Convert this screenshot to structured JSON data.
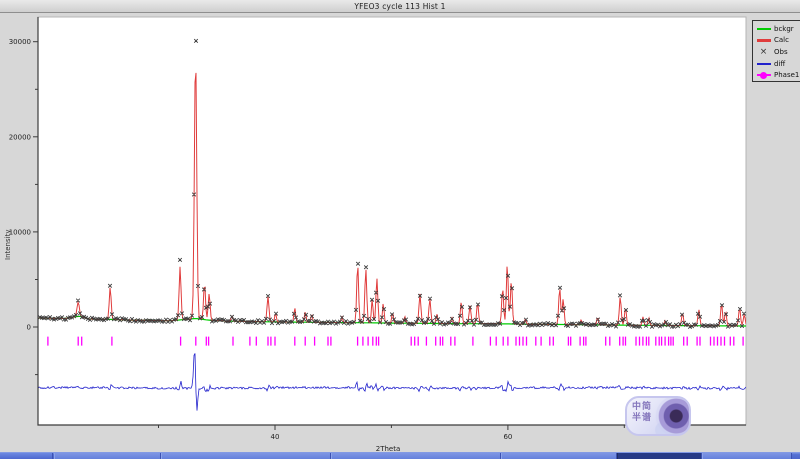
{
  "window": {
    "title": "YFEO3 cycle 113 Hist 1"
  },
  "legend": {
    "items": [
      {
        "label": "bckgr",
        "color": "#00cc00",
        "symbol": "line"
      },
      {
        "label": "Calc",
        "color": "#e03c3c",
        "symbol": "line-thick"
      },
      {
        "label": "Obs",
        "color": "#3a3a3a",
        "symbol": "x-marker"
      },
      {
        "label": "diff",
        "color": "#2222cc",
        "symbol": "line"
      },
      {
        "label": "Phase1",
        "color": "#ff00ff",
        "symbol": "line-diamond"
      }
    ]
  },
  "watermark": {
    "lines": [
      "中简",
      "半谱"
    ]
  },
  "taskbar": {
    "button_count": 6
  },
  "chart_data": {
    "type": "line",
    "title": "YFEO3 cycle 113 Hist 1",
    "xlabel": "2Theta",
    "ylabel": "Intensity",
    "xlim": [
      19.65,
      80.45
    ],
    "ylim": [
      -10300,
      32600
    ],
    "x_ticks_labeled": [
      40,
      60
    ],
    "x_ticks_minor": [
      30,
      50,
      70
    ],
    "y_ticks_labeled": [
      0,
      10000,
      20000,
      30000
    ],
    "y_ticks_minor": [
      -5000,
      5000,
      15000,
      25000
    ],
    "grid": false,
    "legend_position": "top-right",
    "series_names": [
      "bckgr",
      "Calc",
      "Obs",
      "diff",
      "Phase1"
    ],
    "background_points": [
      [
        19.65,
        950
      ],
      [
        22.0,
        900
      ],
      [
        23.2,
        1150
      ],
      [
        24.0,
        850
      ],
      [
        26.0,
        800
      ],
      [
        28.0,
        720
      ],
      [
        31.0,
        660
      ],
      [
        33.2,
        900
      ],
      [
        34.5,
        700
      ],
      [
        36.0,
        620
      ],
      [
        40.0,
        540
      ],
      [
        45.0,
        480
      ],
      [
        50.0,
        420
      ],
      [
        55.0,
        360
      ],
      [
        60.0,
        330
      ],
      [
        65.0,
        260
      ],
      [
        70.0,
        200
      ],
      [
        75.0,
        150
      ],
      [
        80.45,
        110
      ]
    ],
    "peaks": [
      [
        23.1,
        1500,
        0.1
      ],
      [
        25.85,
        3400,
        0.08
      ],
      [
        31.85,
        5600,
        0.08
      ],
      [
        33.18,
        27800,
        0.1
      ],
      [
        33.95,
        3900,
        0.08
      ],
      [
        34.35,
        2800,
        0.08
      ],
      [
        36.3,
        500,
        0.08
      ],
      [
        39.4,
        2700,
        0.08
      ],
      [
        40.05,
        900,
        0.07
      ],
      [
        41.7,
        1500,
        0.07
      ],
      [
        42.6,
        1100,
        0.07
      ],
      [
        43.15,
        800,
        0.07
      ],
      [
        45.75,
        600,
        0.07
      ],
      [
        47.1,
        6200,
        0.08
      ],
      [
        47.8,
        5700,
        0.08
      ],
      [
        48.35,
        2500,
        0.07
      ],
      [
        48.75,
        4700,
        0.08
      ],
      [
        49.3,
        2100,
        0.07
      ],
      [
        50.1,
        1100,
        0.07
      ],
      [
        51.15,
        700,
        0.07
      ],
      [
        52.45,
        3100,
        0.08
      ],
      [
        53.3,
        2600,
        0.08
      ],
      [
        53.9,
        1000,
        0.07
      ],
      [
        55.2,
        600,
        0.07
      ],
      [
        56.0,
        2300,
        0.08
      ],
      [
        56.75,
        1900,
        0.08
      ],
      [
        57.4,
        2200,
        0.08
      ],
      [
        59.55,
        3800,
        0.08
      ],
      [
        59.95,
        6300,
        0.08
      ],
      [
        60.3,
        4600,
        0.08
      ],
      [
        61.5,
        500,
        0.07
      ],
      [
        64.45,
        3900,
        0.08
      ],
      [
        64.75,
        2700,
        0.08
      ],
      [
        66.3,
        500,
        0.07
      ],
      [
        67.7,
        800,
        0.07
      ],
      [
        69.65,
        3000,
        0.08
      ],
      [
        70.1,
        1800,
        0.08
      ],
      [
        71.6,
        900,
        0.07
      ],
      [
        72.1,
        800,
        0.07
      ],
      [
        73.5,
        500,
        0.07
      ],
      [
        75.0,
        1300,
        0.08
      ],
      [
        76.4,
        1700,
        0.08
      ],
      [
        78.35,
        2300,
        0.08
      ],
      [
        78.7,
        1500,
        0.08
      ],
      [
        79.9,
        1900,
        0.08
      ],
      [
        80.3,
        1200,
        0.08
      ]
    ],
    "obs_extra_peaks": [
      [
        33.18,
        3200,
        0.1
      ],
      [
        31.85,
        900,
        0.08
      ],
      [
        47.1,
        500,
        0.08
      ],
      [
        59.95,
        500,
        0.08
      ]
    ],
    "diff_offset": -6400,
    "diff_mismatch": 0.1,
    "diff_mismatch_main": 0.14,
    "diff_noise": 110,
    "phase1_positions": [
      20.5,
      23.1,
      23.4,
      26.0,
      31.9,
      33.2,
      34.1,
      34.3,
      36.4,
      37.85,
      38.4,
      39.4,
      39.65,
      40.0,
      41.7,
      42.6,
      43.4,
      44.55,
      44.8,
      47.1,
      47.55,
      48.0,
      48.4,
      48.7,
      48.9,
      51.7,
      52.0,
      52.3,
      53.0,
      53.8,
      54.2,
      54.4,
      55.1,
      55.45,
      57.0,
      58.5,
      59.0,
      59.6,
      60.0,
      60.7,
      61.0,
      61.3,
      61.6,
      62.4,
      62.85,
      63.6,
      63.9,
      65.2,
      65.4,
      66.2,
      66.5,
      66.7,
      68.4,
      68.75,
      69.6,
      69.9,
      70.1,
      71.0,
      71.3,
      71.6,
      71.9,
      72.1,
      72.7,
      73.0,
      73.2,
      73.5,
      73.8,
      74.0,
      74.2,
      75.1,
      75.4,
      76.25,
      76.5,
      77.4,
      77.7,
      78.0,
      78.3,
      78.6,
      79.1,
      79.4,
      80.2
    ]
  }
}
